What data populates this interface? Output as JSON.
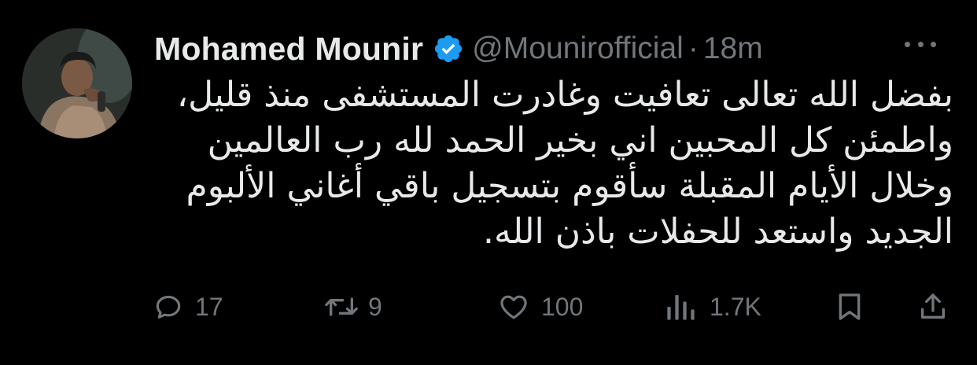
{
  "tweet": {
    "display_name": "Mohamed Mounir",
    "handle": "@Mounirofficial",
    "separator": "·",
    "time": "18m",
    "verified_color": "#1d9bf0",
    "body_lines": [
      "بفضل الله تعالى تعافيت وغادرت المستشفى منذ قليل،",
      "واطمئن كل المحبين اني بخير  الحمد لله رب العالمين",
      " وخلال الأيام المقبلة سأقوم بتسجيل باقي أغاني الألبوم",
      "الجديد واستعد للحفلات باذن الله."
    ]
  },
  "actions": {
    "reply": {
      "icon": "reply-icon",
      "count": "17"
    },
    "retweet": {
      "icon": "retweet-icon",
      "count": "9"
    },
    "like": {
      "icon": "heart-icon",
      "count": "100"
    },
    "views": {
      "icon": "views-icon",
      "count": "1.7K"
    },
    "bookmark": {
      "icon": "bookmark-icon"
    },
    "share": {
      "icon": "share-icon"
    }
  },
  "colors": {
    "background": "#000000",
    "text_primary": "#e7e9ea",
    "text_secondary": "#71767b",
    "accent": "#1d9bf0"
  }
}
